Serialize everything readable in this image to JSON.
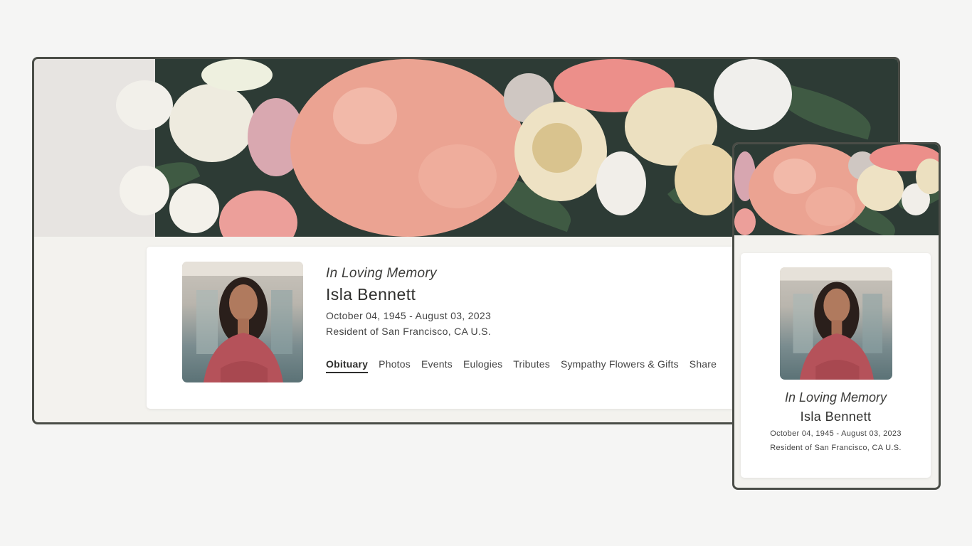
{
  "desktop": {
    "memory": "In Loving Memory",
    "name": "Isla Bennett",
    "dates": "October 04, 1945 - August 03, 2023",
    "resident": "Resident of San Francisco, CA U.S.",
    "tabs": [
      {
        "label": "Obituary",
        "active": true
      },
      {
        "label": "Photos",
        "active": false
      },
      {
        "label": "Events",
        "active": false
      },
      {
        "label": "Eulogies",
        "active": false
      },
      {
        "label": "Tributes",
        "active": false
      },
      {
        "label": "Sympathy Flowers & Gifts",
        "active": false
      },
      {
        "label": "Share",
        "active": false
      }
    ]
  },
  "mobile": {
    "memory": "In Loving Memory",
    "name": "Isla Bennett",
    "dates": "October 04, 1945 - August 03, 2023",
    "resident": "Resident of San Francisco, CA U.S."
  },
  "colors": {
    "page_background": "#f5f5f4",
    "frame_border": "#4a4d47",
    "panel_background": "#f3f2ee",
    "card_background": "#ffffff",
    "hydrangea_pink": "#e9a08f",
    "cream_rose": "#eee2c4",
    "white_rose": "#f2f0ea",
    "foliage": "#3f5a43"
  }
}
